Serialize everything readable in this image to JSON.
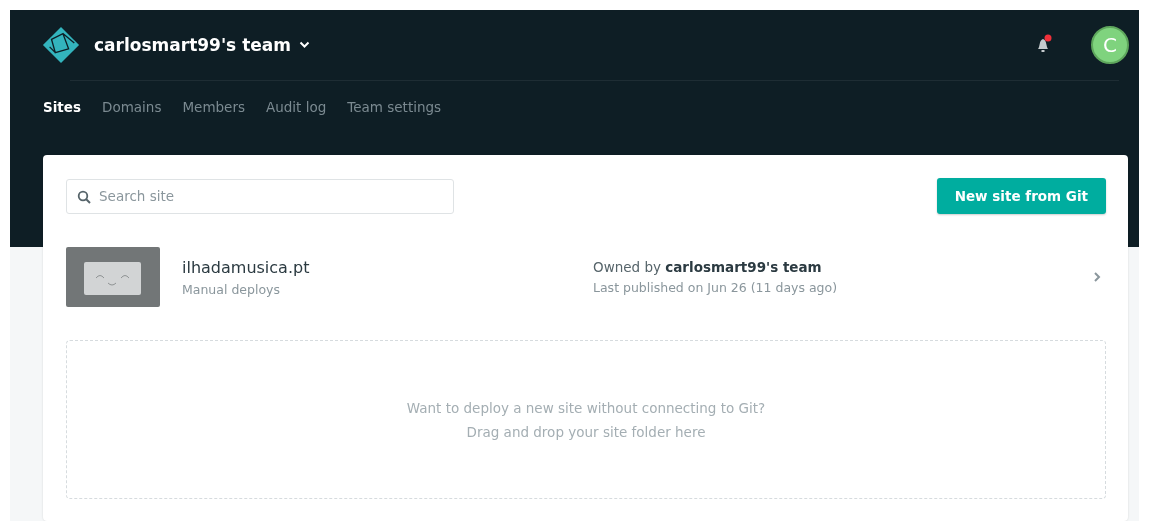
{
  "header": {
    "team_name": "carlosmart99's team",
    "notifications": {
      "unread": true
    },
    "avatar": {
      "initial": "C"
    }
  },
  "tabs": [
    {
      "label": "Sites",
      "selected": true
    },
    {
      "label": "Domains",
      "selected": false
    },
    {
      "label": "Members",
      "selected": false
    },
    {
      "label": "Audit log",
      "selected": false
    },
    {
      "label": "Team settings",
      "selected": false
    }
  ],
  "search": {
    "placeholder": "Search site"
  },
  "new_site_button": "New site from Git",
  "sites": [
    {
      "name": "ilhadamusica.pt",
      "deploy_type": "Manual deploys",
      "owner": "Owned by **carlosmart99's team**",
      "published": "Last published on Jun 26 (11 days ago)"
    }
  ],
  "dropzone": {
    "line_1": "Want to deploy a new site without connecting to Git?",
    "line_2": "Drag and drop your site folder here"
  }
}
